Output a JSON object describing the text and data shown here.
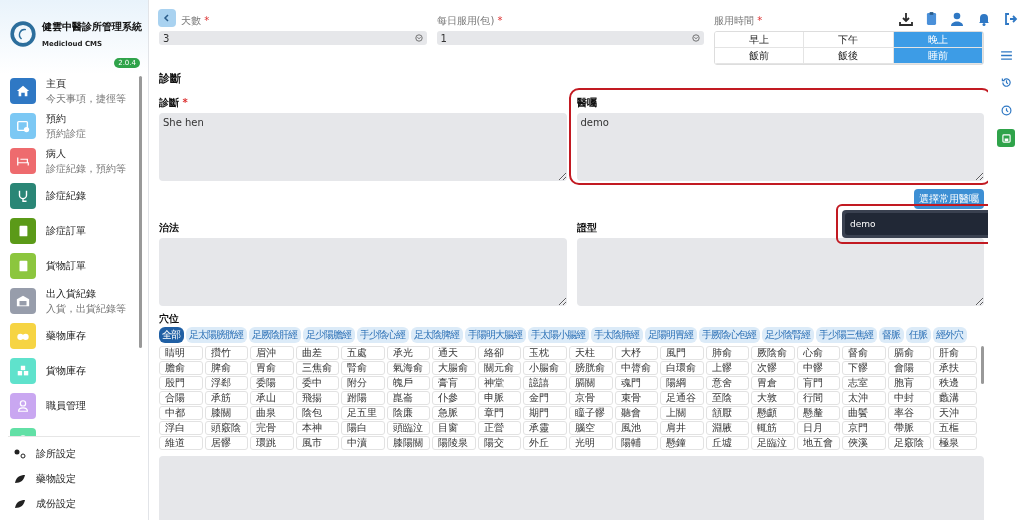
{
  "sidebar": {
    "brand": {
      "title": "健雲中醫診所管理系統",
      "subtitle": "Medicloud CMS",
      "version": "2.0.4"
    },
    "items": [
      {
        "title": "主頁",
        "subtitle": "今天事項，捷徑等",
        "color": "#2f78c4"
      },
      {
        "title": "預約",
        "subtitle": "預約診症",
        "color": "#7cc8f4"
      },
      {
        "title": "病人",
        "subtitle": "診症紀錄，預約等",
        "color": "#ee6b6e"
      },
      {
        "title": "診症紀錄",
        "color": "#2a8676"
      },
      {
        "title": "診症訂單",
        "color": "#5b9a18"
      },
      {
        "title": "貨物訂單",
        "color": "#8cc63e"
      },
      {
        "title": "出入貨紀錄",
        "subtitle": "入貨，出貨紀錄等",
        "color": "#979dab"
      },
      {
        "title": "藥物庫存",
        "color": "#f6d443"
      },
      {
        "title": "貨物庫存",
        "color": "#5fe2cc"
      },
      {
        "title": "職員管理",
        "color": "#c9a7f1"
      },
      {
        "color": "#62e0a6"
      }
    ],
    "settings": [
      "診所設定",
      "藥物設定",
      "成份設定"
    ]
  },
  "prescription": {
    "fields": [
      {
        "label": "天數",
        "required_mark": "*",
        "value": "3"
      },
      {
        "label": "每日服用(包)",
        "required_mark": "*",
        "value": "1"
      }
    ],
    "timing": {
      "label": "服用時間",
      "required_mark": "*",
      "options": [
        {
          "label": "早上",
          "selected": false
        },
        {
          "label": "下午",
          "selected": false
        },
        {
          "label": "晚上",
          "selected": true
        },
        {
          "label": "飯前",
          "selected": false
        },
        {
          "label": "飯後",
          "selected": false
        },
        {
          "label": "睡前",
          "selected": true
        }
      ]
    }
  },
  "diagnosis_section": {
    "title": "診斷",
    "fields": [
      {
        "label": "診斷",
        "required_mark": "*",
        "value": "She hen"
      },
      {
        "label": "醫囑",
        "value": "demo",
        "highlighted": true
      }
    ]
  },
  "common_advice_button": "選擇常用醫囑",
  "advice_suggestions": {
    "highlighted": true,
    "items": [
      "demo"
    ]
  },
  "treatment_fields": [
    {
      "label": "治法"
    },
    {
      "label": "證型"
    }
  ],
  "acupoints": {
    "label": "穴位",
    "tabs": [
      {
        "label": "全部",
        "selected": true
      },
      {
        "label": "足太陽膀胱經",
        "selected": false
      },
      {
        "label": "足厥陰肝經",
        "selected": false
      },
      {
        "label": "足少陽膽經",
        "selected": false
      },
      {
        "label": "手少陰心經",
        "selected": false
      },
      {
        "label": "足太陰脾經",
        "selected": false
      },
      {
        "label": "手陽明大腸經",
        "selected": false
      },
      {
        "label": "手太陽小腸經",
        "selected": false
      },
      {
        "label": "手太陰肺經",
        "selected": false
      },
      {
        "label": "足陽明胃經",
        "selected": false
      },
      {
        "label": "手厥陰心包經",
        "selected": false
      },
      {
        "label": "足少陰腎經",
        "selected": false
      },
      {
        "label": "手少陽三焦經",
        "selected": false
      },
      {
        "label": "督脈",
        "selected": false
      },
      {
        "label": "任脈",
        "selected": false
      },
      {
        "label": "經外穴",
        "selected": false
      }
    ],
    "points": [
      "睛明",
      "攢竹",
      "眉沖",
      "曲差",
      "五處",
      "承光",
      "通天",
      "絡卻",
      "玉枕",
      "天柱",
      "大杼",
      "風門",
      "肺俞",
      "厥陰俞",
      "心俞",
      "督俞",
      "膈俞",
      "肝俞",
      "膽俞",
      "脾俞",
      "胃俞",
      "三焦俞",
      "腎俞",
      "氣海俞",
      "大腸俞",
      "關元俞",
      "小腸俞",
      "膀胱俞",
      "中膂俞",
      "白環俞",
      "上髎",
      "次髎",
      "中髎",
      "下髎",
      "會陽",
      "承扶",
      "殷門",
      "浮郄",
      "委陽",
      "委中",
      "附分",
      "魄戶",
      "膏肓",
      "神堂",
      "譩譆",
      "膈關",
      "魂門",
      "陽綱",
      "意舍",
      "胃倉",
      "肓門",
      "志室",
      "胞肓",
      "秩邊",
      "合陽",
      "承筋",
      "承山",
      "飛揚",
      "跗陽",
      "崑崙",
      "仆參",
      "申脈",
      "金門",
      "京骨",
      "束骨",
      "足通谷",
      "至陰",
      "大敦",
      "行間",
      "太沖",
      "中封",
      "蠡溝",
      "中都",
      "膝關",
      "曲泉",
      "陰包",
      "足五里",
      "陰廉",
      "急脈",
      "章門",
      "期門",
      "瞳子髎",
      "聽會",
      "上關",
      "頷厭",
      "懸顱",
      "懸釐",
      "曲鬢",
      "率谷",
      "天沖",
      "浮白",
      "頭竅陰",
      "完骨",
      "本神",
      "陽白",
      "頭臨泣",
      "目窗",
      "正營",
      "承靈",
      "腦空",
      "風池",
      "肩井",
      "淵腋",
      "輒筋",
      "日月",
      "京門",
      "帶脈",
      "五樞",
      "維道",
      "居髎",
      "環跳",
      "風市",
      "中瀆",
      "膝陽關",
      "陽陵泉",
      "陽交",
      "外丘",
      "光明",
      "陽輔",
      "懸鐘",
      "丘墟",
      "足臨泣",
      "地五會",
      "俠溪",
      "足竅陰",
      "極泉"
    ]
  }
}
